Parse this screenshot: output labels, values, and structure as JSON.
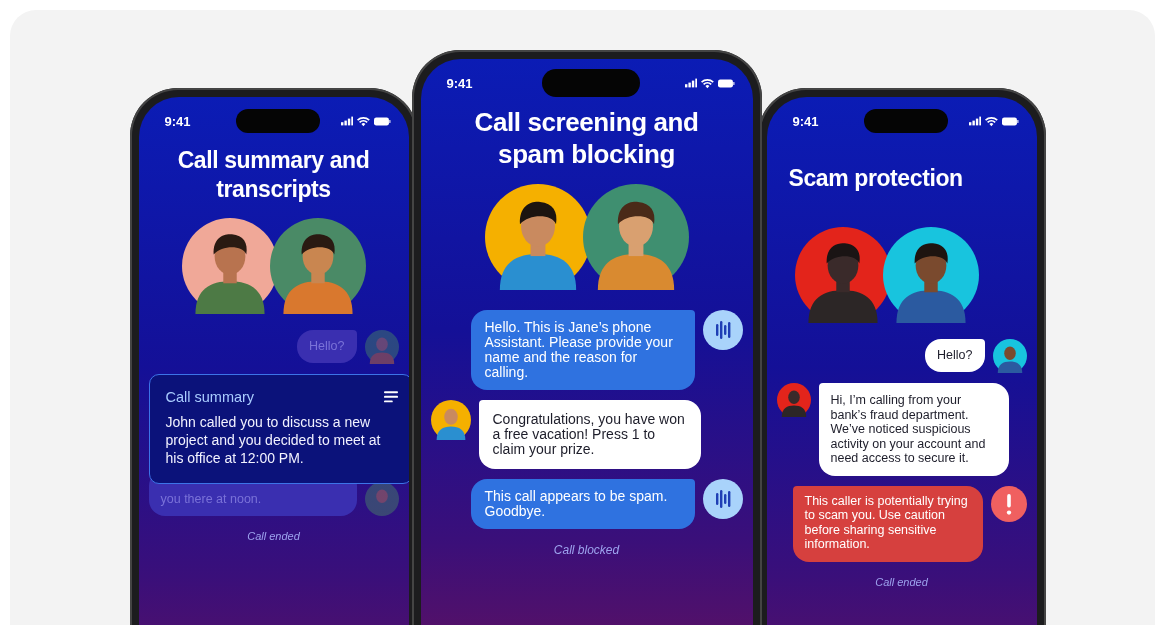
{
  "phones": [
    {
      "time": "9:41",
      "title": "Call summary and transcripts",
      "messages": [
        {
          "kind": "outgoing",
          "faded": true,
          "text": "Hello?"
        }
      ],
      "summary": {
        "title": "Call summary",
        "text": "John called you to discuss a new project and you decided to meet at his office at 12:00 PM."
      },
      "after_messages": [
        {
          "kind": "outgoing",
          "faded": true,
          "text": "you there at noon."
        }
      ],
      "footer": "Call ended"
    },
    {
      "time": "9:41",
      "title": "Call screening and spam blocking",
      "messages": [
        {
          "kind": "assistant",
          "faded": false,
          "text": "Hello. This is Jane’s phone Assistant. Please provide your name and the reason for calling."
        },
        {
          "kind": "incoming",
          "faded": false,
          "text": "Congratulations, you have won a free vacation! Press 1 to claim your prize."
        },
        {
          "kind": "assistant",
          "faded": false,
          "text": "This call appears to be spam. Goodbye."
        }
      ],
      "footer": "Call blocked"
    },
    {
      "time": "9:41",
      "title": "Scam protection",
      "messages": [
        {
          "kind": "outgoing",
          "faded": false,
          "text": "Hello?"
        },
        {
          "kind": "incoming",
          "faded": false,
          "text": "Hi, I’m calling from your bank’s fraud department. We’ve noticed suspicious activity on your account and need access to secure it."
        },
        {
          "kind": "warning",
          "faded": false,
          "text": "This caller is potentially trying to scam you. Use caution before sharing sensitive information."
        }
      ],
      "footer": "Call ended"
    }
  ]
}
